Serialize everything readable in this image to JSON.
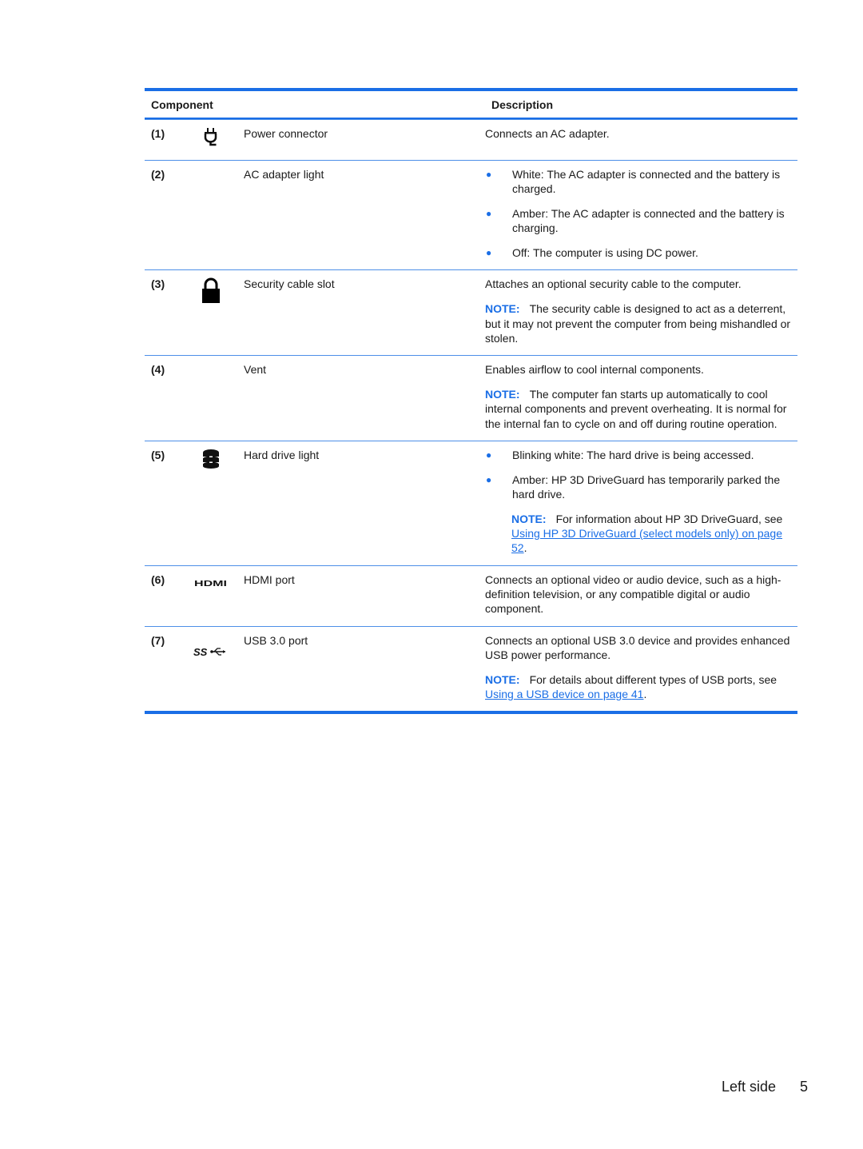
{
  "table": {
    "header": {
      "component": "Component",
      "description": "Description"
    },
    "rows": [
      {
        "num": "(1)",
        "icon": "power-plug-icon",
        "name": "Power connector",
        "desc_text": "Connects an AC adapter."
      },
      {
        "num": "(2)",
        "icon": "",
        "name": "AC adapter light",
        "bullets": [
          "White: The AC adapter is connected and the battery is charged.",
          "Amber: The AC adapter is connected and the battery is charging.",
          "Off: The computer is using DC power."
        ]
      },
      {
        "num": "(3)",
        "icon": "lock-icon",
        "name": "Security cable slot",
        "desc_text": "Attaches an optional security cable to the computer.",
        "note_label": "NOTE:",
        "note_text": "The security cable is designed to act as a deterrent, but it may not prevent the computer from being mishandled or stolen."
      },
      {
        "num": "(4)",
        "icon": "",
        "name": "Vent",
        "desc_text": "Enables airflow to cool internal components.",
        "note_label": "NOTE:",
        "note_text": "The computer fan starts up automatically to cool internal components and prevent overheating. It is normal for the internal fan to cycle on and off during routine operation."
      },
      {
        "num": "(5)",
        "icon": "hard-drive-icon",
        "name": "Hard drive light",
        "bullets": [
          "Blinking white: The hard drive is being accessed.",
          "Amber: HP 3D DriveGuard has temporarily parked the hard drive."
        ],
        "note_label": "NOTE:",
        "note_text": "For information about HP 3D DriveGuard, see",
        "note_link": "Using HP 3D DriveGuard (select models only) on page 52",
        "note_after": "."
      },
      {
        "num": "(6)",
        "icon": "hdmi-icon",
        "name": "HDMI port",
        "desc_text": "Connects an optional video or audio device, such as a high-definition television, or any compatible digital or audio component."
      },
      {
        "num": "(7)",
        "icon": "usb-ss-icon",
        "name": "USB 3.0 port",
        "desc_text": "Connects an optional USB 3.0 device and provides enhanced USB power performance.",
        "note_label": "NOTE:",
        "note_text": "For details about different types of USB ports, see",
        "note_link": "Using a USB device on page 41",
        "note_after": "."
      }
    ]
  },
  "footer": {
    "section": "Left side",
    "page_number": "5"
  },
  "colors": {
    "accent": "#1a6ee6",
    "text": "#1a1a1a"
  }
}
